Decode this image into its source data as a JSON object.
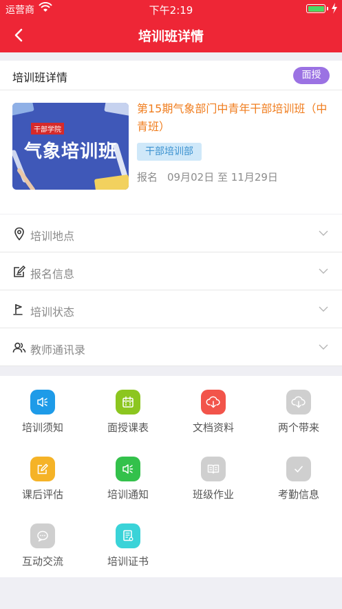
{
  "status_bar": {
    "carrier": "运营商",
    "time": "下午2:19"
  },
  "nav": {
    "title": "培训班详情"
  },
  "card": {
    "header_title": "培训班详情",
    "mode_badge": "面授",
    "cover_tag": "干部学院",
    "cover_text": "气象培训班",
    "course_title": "第15期气象部门中青年干部培训班（中青班）",
    "department": "干部培训部",
    "signup_label": "报名",
    "signup_range": "09月02日 至 11月29日"
  },
  "rows": [
    {
      "label": "培训地点",
      "icon": "location-icon"
    },
    {
      "label": "报名信息",
      "icon": "edit-icon"
    },
    {
      "label": "培训状态",
      "icon": "flag-icon"
    },
    {
      "label": "教师通讯录",
      "icon": "contacts-icon"
    }
  ],
  "tiles": [
    {
      "label": "培训须知",
      "icon": "speaker-icon",
      "color": "#1e9be8"
    },
    {
      "label": "面授课表",
      "icon": "calendar-icon",
      "color": "#8cc61f"
    },
    {
      "label": "文档资料",
      "icon": "cloud-download-icon",
      "color": "#f2544a"
    },
    {
      "label": "两个带来",
      "icon": "cloud-download-icon",
      "color": "#cfcfcf"
    },
    {
      "label": "课后评估",
      "icon": "pencil-icon",
      "color": "#f5b327"
    },
    {
      "label": "培训通知",
      "icon": "speaker-icon",
      "color": "#33c14b"
    },
    {
      "label": "班级作业",
      "icon": "book-icon",
      "color": "#cfcfcf"
    },
    {
      "label": "考勤信息",
      "icon": "check-icon",
      "color": "#cfcfcf"
    },
    {
      "label": "互动交流",
      "icon": "chat-icon",
      "color": "#cfcfcf"
    },
    {
      "label": "培训证书",
      "icon": "certificate-icon",
      "color": "#3ad3d8"
    }
  ],
  "colors": {
    "brand_red": "#ee2636",
    "badge_purple": "#9b72e3",
    "title_orange": "#f07d1e"
  }
}
